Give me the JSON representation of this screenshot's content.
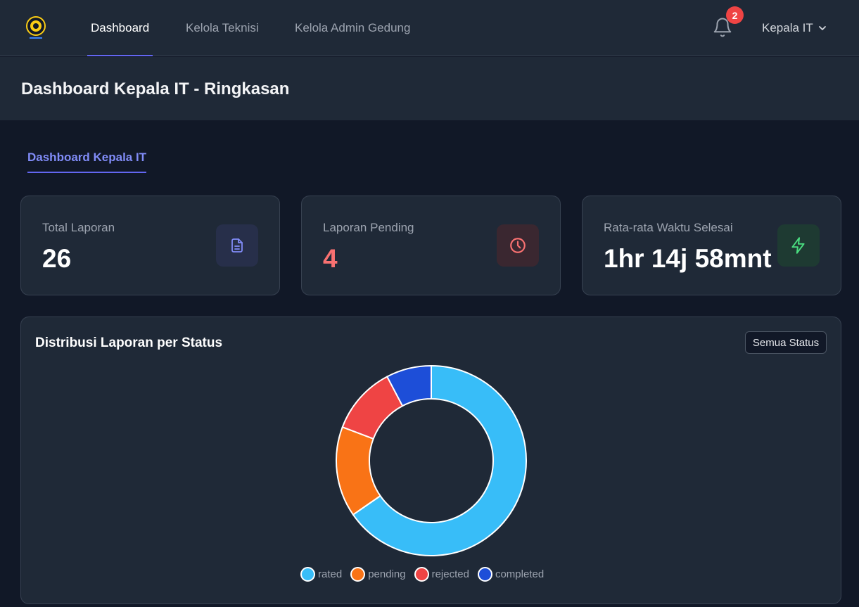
{
  "nav": {
    "items": [
      {
        "label": "Dashboard",
        "active": true
      },
      {
        "label": "Kelola Teknisi",
        "active": false
      },
      {
        "label": "Kelola Admin Gedung",
        "active": false
      }
    ],
    "notification_count": "2",
    "user_label": "Kepala IT"
  },
  "header": {
    "title": "Dashboard Kepala IT - Ringkasan"
  },
  "tabs": [
    {
      "label": "Dashboard Kepala IT",
      "active": true
    }
  ],
  "stats": [
    {
      "label": "Total Laporan",
      "value": "26",
      "icon": "document-icon",
      "accent": "#818cf8"
    },
    {
      "label": "Laporan Pending",
      "value": "4",
      "icon": "clock-icon",
      "accent": "#f87171"
    },
    {
      "label": "Rata-rata Waktu Selesai",
      "value": "1hr 14j 58mnt",
      "icon": "bolt-icon",
      "accent": "#4ade80"
    }
  ],
  "chart_panel": {
    "title": "Distribusi Laporan per Status",
    "filter_label": "Semua Status"
  },
  "chart_data": {
    "type": "pie",
    "variant": "donut",
    "categories": [
      "rated",
      "pending",
      "rejected",
      "completed"
    ],
    "values": [
      17,
      4,
      3,
      2
    ],
    "colors": [
      "#38bdf8",
      "#f97316",
      "#ef4444",
      "#1d4ed8"
    ],
    "legend_position": "bottom"
  }
}
